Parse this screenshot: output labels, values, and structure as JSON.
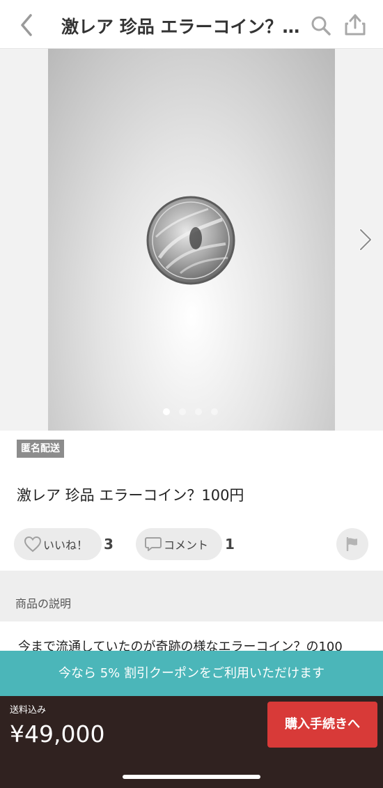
{
  "header": {
    "title": "激レア 珍品  エラーコイン？…"
  },
  "gallery": {
    "page_count": 4,
    "current_page": 1
  },
  "item": {
    "badge": "匿名配送",
    "name": "激レア 珍品  エラーコイン？100円",
    "like_label": "いいね！",
    "like_count": "3",
    "comment_label": "コメント",
    "comment_count": "1"
  },
  "description": {
    "header": "商品の説明",
    "text": "今まで流通していたのが奇跡の様なエラーコイン？の100"
  },
  "coupon": {
    "text": "今なら 5% 割引クーポンをご利用いただけます"
  },
  "purchase": {
    "shipping_note": "送料込み",
    "price": "¥49,000",
    "buy_label": "購入手続きへ"
  },
  "colors": {
    "accent_red": "#d83a38",
    "coupon_teal": "#4bb6b9",
    "bottom_bar": "#302220"
  }
}
